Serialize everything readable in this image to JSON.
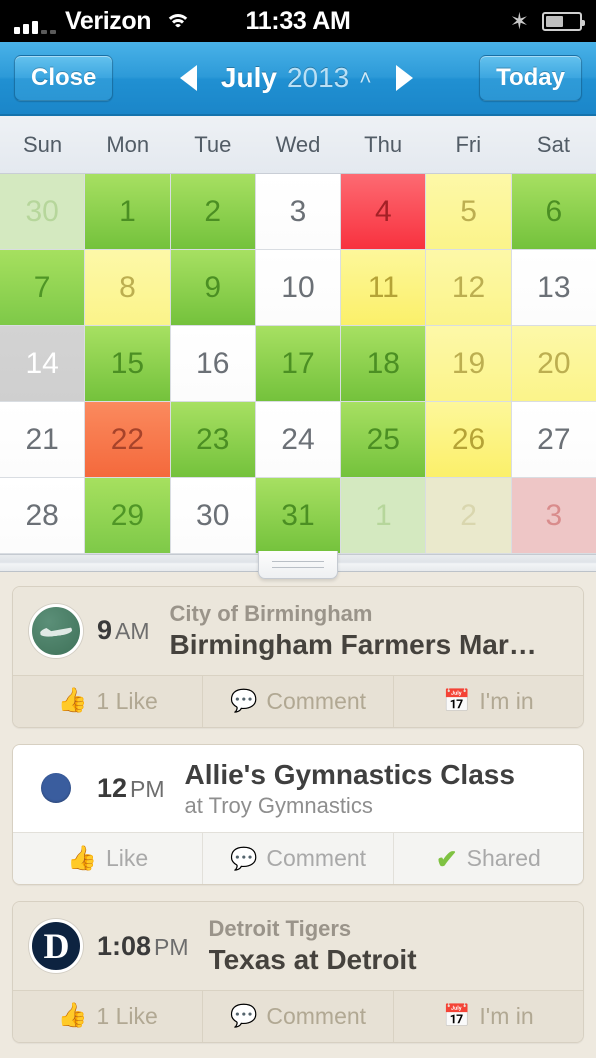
{
  "status_bar": {
    "carrier": "Verizon",
    "time": "11:33 AM",
    "wifi_icon": "wifi-icon",
    "bluetooth_icon": "bluetooth-icon",
    "bluetooth_glyph": "✶",
    "battery_icon": "battery-icon",
    "battery_level_percent": 52
  },
  "nav": {
    "close_label": "Close",
    "today_label": "Today",
    "prev_icon": "previous-month-arrow",
    "next_icon": "next-month-arrow",
    "month": "July",
    "year": "2013",
    "caret": "˄"
  },
  "calendar": {
    "weekdays": [
      "Sun",
      "Mon",
      "Tue",
      "Wed",
      "Thu",
      "Fri",
      "Sat"
    ],
    "selected_day": "14",
    "cells": [
      {
        "day": "30",
        "style": "muted-green"
      },
      {
        "day": "1",
        "style": "green"
      },
      {
        "day": "2",
        "style": "green"
      },
      {
        "day": "3",
        "style": "white"
      },
      {
        "day": "4",
        "style": "red"
      },
      {
        "day": "5",
        "style": "yellow2"
      },
      {
        "day": "6",
        "style": "green"
      },
      {
        "day": "7",
        "style": "green2"
      },
      {
        "day": "8",
        "style": "yellow2"
      },
      {
        "day": "9",
        "style": "green"
      },
      {
        "day": "10",
        "style": "white"
      },
      {
        "day": "11",
        "style": "yellow"
      },
      {
        "day": "12",
        "style": "yellow2"
      },
      {
        "day": "13",
        "style": "white"
      },
      {
        "day": "14",
        "style": "selected"
      },
      {
        "day": "15",
        "style": "green"
      },
      {
        "day": "16",
        "style": "white"
      },
      {
        "day": "17",
        "style": "green"
      },
      {
        "day": "18",
        "style": "green"
      },
      {
        "day": "19",
        "style": "yellow2"
      },
      {
        "day": "20",
        "style": "yellow2"
      },
      {
        "day": "21",
        "style": "white"
      },
      {
        "day": "22",
        "style": "orange"
      },
      {
        "day": "23",
        "style": "green"
      },
      {
        "day": "24",
        "style": "white"
      },
      {
        "day": "25",
        "style": "green"
      },
      {
        "day": "26",
        "style": "yellow"
      },
      {
        "day": "27",
        "style": "white"
      },
      {
        "day": "28",
        "style": "white"
      },
      {
        "day": "29",
        "style": "green2"
      },
      {
        "day": "30",
        "style": "white"
      },
      {
        "day": "31",
        "style": "green"
      },
      {
        "day": "1",
        "style": "muted-green"
      },
      {
        "day": "2",
        "style": "muted-yellow"
      },
      {
        "day": "3",
        "style": "muted-red"
      }
    ]
  },
  "drag_handle": {
    "name": "panel-drag-handle"
  },
  "events": [
    {
      "theme": "beige",
      "avatar": "birmingham-logo-avatar",
      "avatar_kind": "photo bham",
      "time_number": "9",
      "time_period": "AM",
      "subtitle": "City of Birmingham",
      "title": "Birmingham Farmers Mar…",
      "actions": [
        {
          "icon": "thumbs-up-icon",
          "glyph": "👍",
          "label": "1 Like",
          "active": true
        },
        {
          "icon": "comment-icon",
          "glyph": "💬",
          "label": "Comment",
          "active": false
        },
        {
          "icon": "calendar-add-icon",
          "glyph": "📅",
          "label": "I'm in",
          "active": false
        }
      ]
    },
    {
      "theme": "white",
      "avatar": "blue-dot-avatar",
      "avatar_kind": "dot-blue",
      "time_number": "12",
      "time_period": "PM",
      "subtitle": "at Troy Gymnastics",
      "title": "Allie's Gymnastics Class",
      "title_first": true,
      "actions": [
        {
          "icon": "thumbs-up-icon",
          "glyph": "👍",
          "label": "Like",
          "active": false
        },
        {
          "icon": "comment-icon",
          "glyph": "💬",
          "label": "Comment",
          "active": false
        },
        {
          "icon": "check-icon",
          "glyph": "✔",
          "label": "Shared",
          "active": true
        }
      ]
    },
    {
      "theme": "beige",
      "avatar": "detroit-tigers-logo-avatar",
      "avatar_kind": "photo tigers",
      "avatar_glyph": "D",
      "time_number": "1:08",
      "time_period": "PM",
      "subtitle": "Detroit Tigers",
      "title": "Texas at Detroit",
      "actions": [
        {
          "icon": "thumbs-up-icon",
          "glyph": "👍",
          "label": "1 Like",
          "active": false
        },
        {
          "icon": "comment-icon",
          "glyph": "💬",
          "label": "Comment",
          "active": false
        },
        {
          "icon": "calendar-add-icon",
          "glyph": "📅",
          "label": "I'm in",
          "active": false
        }
      ]
    }
  ]
}
